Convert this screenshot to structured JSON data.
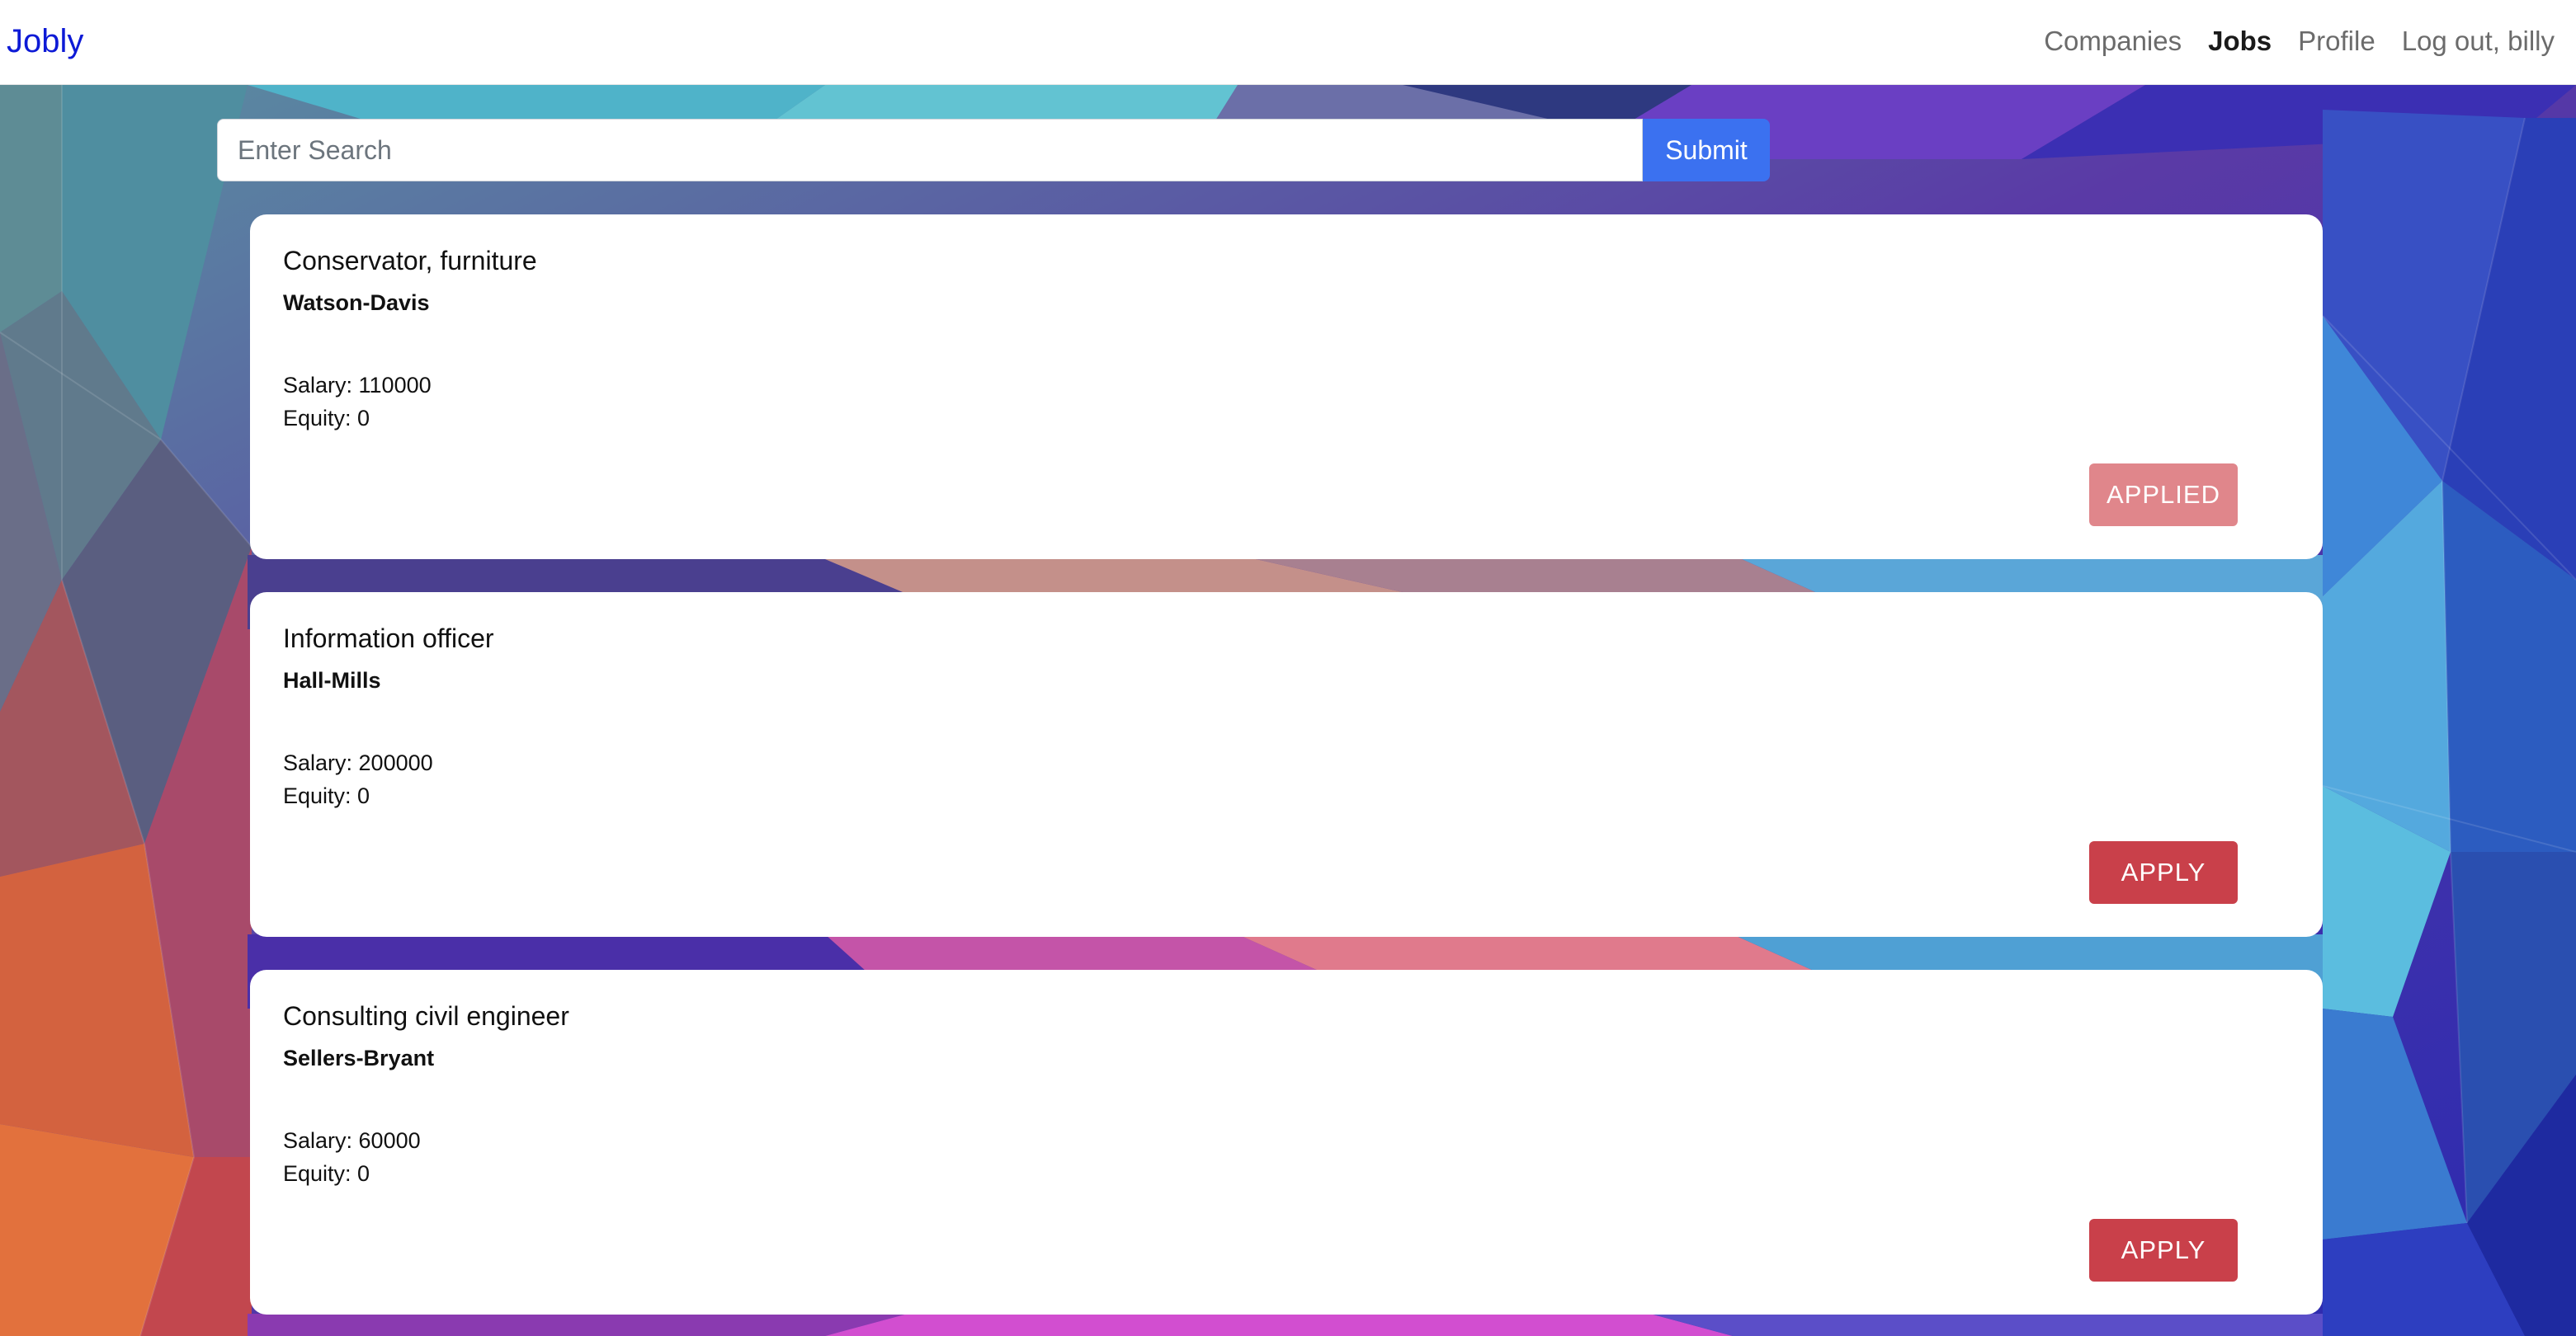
{
  "navbar": {
    "brand": "Jobly",
    "links": [
      {
        "label": "Companies",
        "active": false
      },
      {
        "label": "Jobs",
        "active": true
      },
      {
        "label": "Profile",
        "active": false
      },
      {
        "label": "Log out, billy",
        "active": false
      }
    ]
  },
  "search": {
    "placeholder": "Enter Search",
    "value": "",
    "submit_label": "Submit"
  },
  "jobs": [
    {
      "title": "Conservator, furniture",
      "company": "Watson-Davis",
      "salary": "Salary: 110000",
      "equity": "Equity: 0",
      "button_label": "APPLIED",
      "applied": true
    },
    {
      "title": "Information officer",
      "company": "Hall-Mills",
      "salary": "Salary: 200000",
      "equity": "Equity: 0",
      "button_label": "APPLY",
      "applied": false
    },
    {
      "title": "Consulting civil engineer",
      "company": "Sellers-Bryant",
      "salary": "Salary: 60000",
      "equity": "Equity: 0",
      "button_label": "APPLY",
      "applied": false
    }
  ],
  "colors": {
    "brand": "#0d1ad6",
    "submit": "#3b71f0",
    "apply": "#c9404a",
    "applied": "#e0868b"
  }
}
